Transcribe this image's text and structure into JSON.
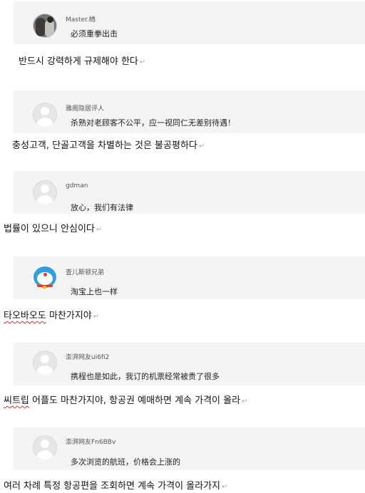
{
  "return_mark": "↵",
  "posts": [
    {
      "avatar": "photo-avatar",
      "username": "Master.楢",
      "comment": "必须重拳出击",
      "translation": "반드시 강력하게 규제해야 한다",
      "translation_lead": "",
      "translation_rest": ""
    },
    {
      "avatar": "default-avatar",
      "username": "雅阁隐居评人",
      "comment": "杀熟对老顾客不公平，应一视同仁无差别待遇！",
      "translation": "충성고객, 단골고객을 차별하는 것은 불공평하다",
      "translation_lead": "",
      "translation_rest": ""
    },
    {
      "avatar": "default-avatar",
      "username": "gdman",
      "comment": "放心，我们有法律",
      "translation": "법률이 있으니 안심이다",
      "translation_lead": "",
      "translation_rest": ""
    },
    {
      "avatar": "doraemon-avatar",
      "username": "査儿斯顿兄弟",
      "comment": "淘宝上也一样",
      "translation": "",
      "translation_lead": "타오바오도",
      "translation_rest": " 마찬가지야"
    },
    {
      "avatar": "default-avatar",
      "username": "澎湃网友ui6fi2",
      "comment": "携程也是如此，我订的机票经常被贵了很多",
      "translation": "",
      "translation_lead": "씨트립",
      "translation_rest": " 어플도 마찬가지야, 항공권 예매하면 계속 가격이 올라"
    },
    {
      "avatar": "default-avatar",
      "username": "澎湃网友Fn6BBv",
      "comment": "多次浏览的航班，价格会上涨的",
      "translation": "여러 차례 특정 항공편을 조회하면 계속 가격이 올라가지",
      "translation_lead": "",
      "translation_rest": ""
    }
  ]
}
